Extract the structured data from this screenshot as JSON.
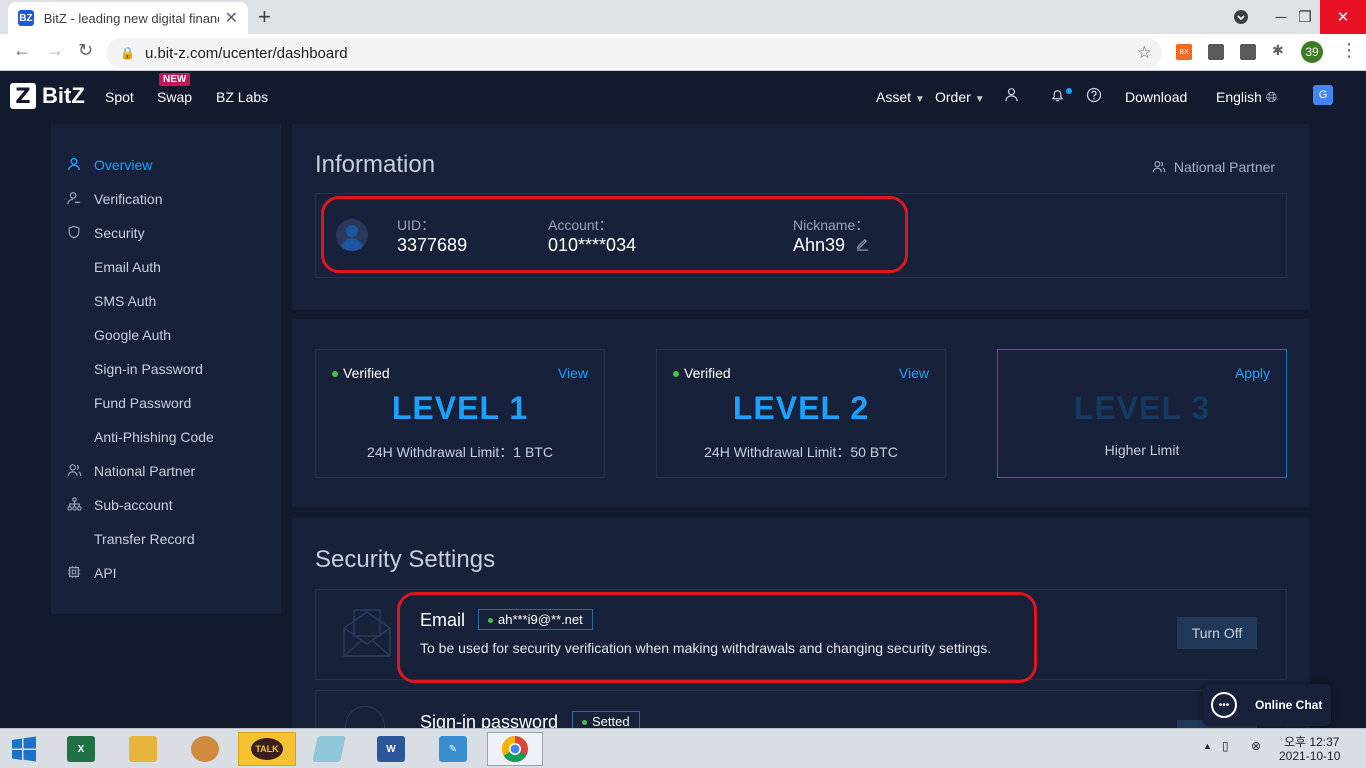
{
  "browser": {
    "tab_title": "BitZ - leading new digital financ",
    "tab_favicon": "BZ",
    "url": "u.bit-z.com/ucenter/dashboard",
    "profile_badge": "39",
    "ext_label": "BX"
  },
  "nav": {
    "logo_letter": "Z",
    "logo_text": "BitZ",
    "links": [
      "Spot",
      "Swap",
      "BZ Labs"
    ],
    "new_badge": "NEW",
    "asset": "Asset",
    "order": "Order",
    "download": "Download",
    "language": "English"
  },
  "sidebar": {
    "items": [
      {
        "label": "Overview",
        "icon": "user-icon"
      },
      {
        "label": "Verification",
        "icon": "user-check-icon"
      },
      {
        "label": "Security",
        "icon": "shield-icon"
      },
      {
        "label": "Email Auth"
      },
      {
        "label": "SMS Auth"
      },
      {
        "label": "Google Auth"
      },
      {
        "label": "Sign-in Password"
      },
      {
        "label": "Fund Password"
      },
      {
        "label": "Anti-Phishing Code"
      },
      {
        "label": "National Partner",
        "icon": "partner-icon"
      },
      {
        "label": "Sub-account",
        "icon": "org-icon"
      },
      {
        "label": "Transfer Record"
      },
      {
        "label": "API",
        "icon": "chip-icon"
      }
    ]
  },
  "information": {
    "title": "Information",
    "partner_link": "National Partner",
    "uid_label": "UID：",
    "uid": "3377689",
    "account_label": "Account：",
    "account": "010****034",
    "nickname_label": "Nickname：",
    "nickname": "Ahn39"
  },
  "levels": [
    {
      "status": "Verified",
      "action": "View",
      "level": "LEVEL 1",
      "limit": "24H Withdrawal Limit：1 BTC"
    },
    {
      "status": "Verified",
      "action": "View",
      "level": "LEVEL 2",
      "limit": "24H Withdrawal Limit：50 BTC"
    },
    {
      "status": "",
      "action": "Apply",
      "level": "LEVEL 3",
      "limit": "Higher Limit"
    }
  ],
  "security": {
    "title": "Security Settings",
    "email": {
      "title": "Email",
      "tag": "ah***i9@**.net",
      "desc": "To be used for security verification when making withdrawals and changing security settings.",
      "button": "Turn Off"
    },
    "password": {
      "title": "Sign-in password",
      "tag": "Setted"
    }
  },
  "chat": {
    "label": "Online Chat"
  },
  "taskbar": {
    "time": "오후 12:37",
    "date": "2021-10-10",
    "talk_label": "TALK"
  },
  "colors": {
    "accent": "#1ca1ff",
    "page_bg": "#131a2e",
    "panel_bg": "#18213a",
    "verified_dot": "#47c14b",
    "highlight_red": "#e0151f"
  }
}
